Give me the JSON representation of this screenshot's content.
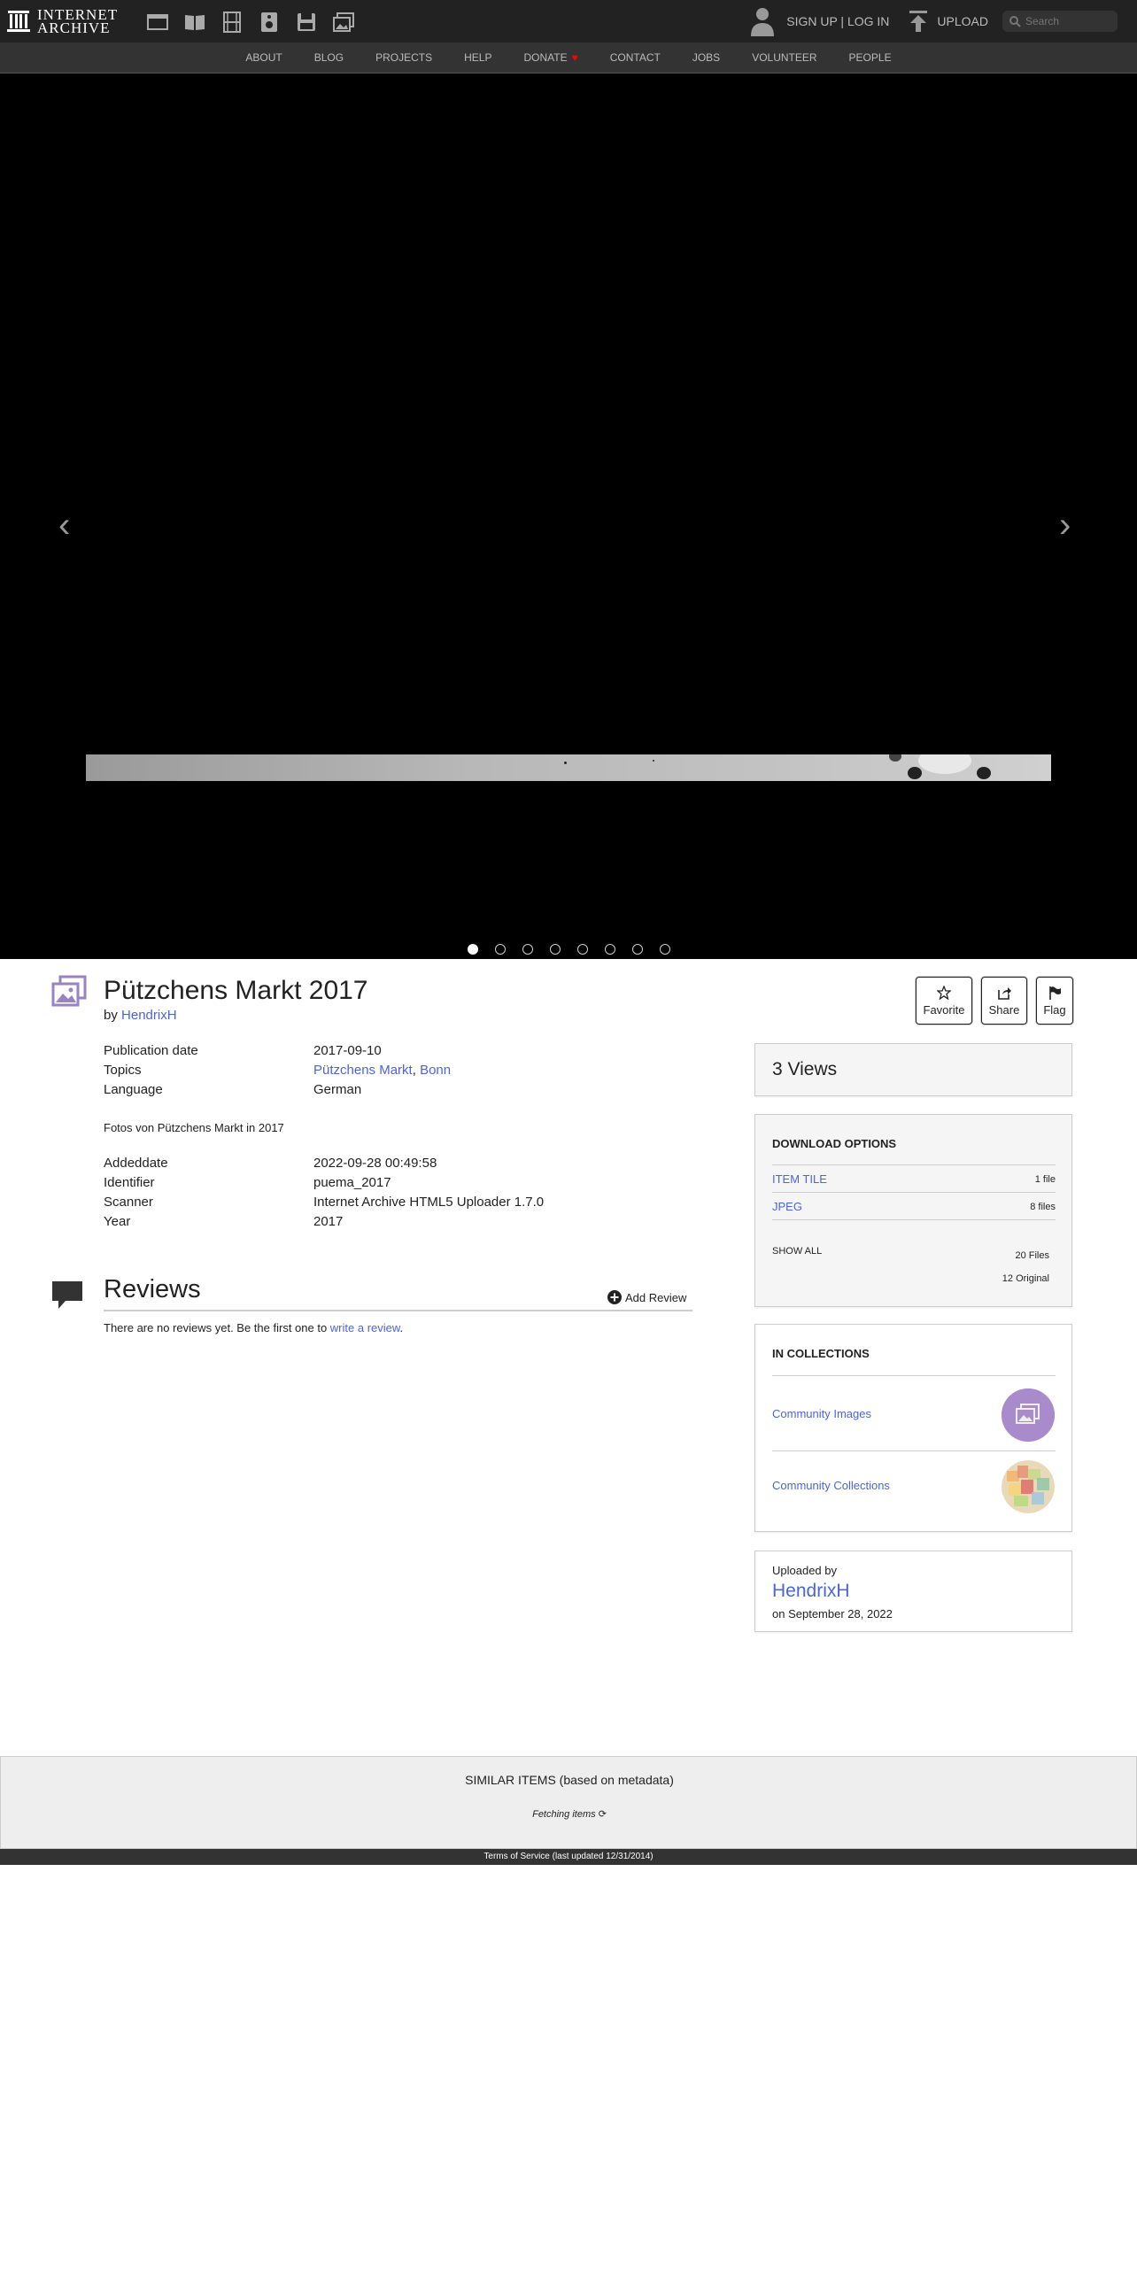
{
  "topnav": {
    "logo_text_line1": "INTERNET",
    "logo_text_line2": "ARCHIVE",
    "media_icons": [
      "web-icon",
      "texts-icon",
      "video-icon",
      "audio-icon",
      "software-icon",
      "images-icon"
    ],
    "auth_label": "SIGN UP | LOG IN",
    "upload_label": "UPLOAD",
    "search_placeholder": "Search"
  },
  "subnav": {
    "items": [
      "ABOUT",
      "BLOG",
      "PROJECTS",
      "HELP",
      "DONATE",
      "CONTACT",
      "JOBS",
      "VOLUNTEER",
      "PEOPLE"
    ]
  },
  "theater": {
    "slide_count": 8,
    "active_slide": 1,
    "prev_label": "‹",
    "next_label": "›"
  },
  "item": {
    "title": "Pützchens Markt 2017",
    "by_label": "by",
    "creator": "HendrixH",
    "actions": {
      "favorite": "Favorite",
      "share": "Share",
      "flag": "Flag"
    },
    "metadata": {
      "publication_date_key": "Publication date",
      "publication_date_val": "2017-09-10",
      "topics_key": "Topics",
      "topic_1": "Pützchens Markt",
      "topic_sep": ", ",
      "topic_2": "Bonn",
      "language_key": "Language",
      "language_val": "German",
      "description": "Fotos von Pützchens Markt in 2017",
      "addeddate_key": "Addeddate",
      "addeddate_val": "2022-09-28 00:49:58",
      "identifier_key": "Identifier",
      "identifier_val": "puema_2017",
      "scanner_key": "Scanner",
      "scanner_val": "Internet Archive HTML5 Uploader 1.7.0",
      "year_key": "Year",
      "year_val": "2017"
    }
  },
  "reviews": {
    "title": "Reviews",
    "add_label": "Add Review",
    "empty_text": "There are no reviews yet. Be the first one to ",
    "empty_link": "write a review",
    "empty_end": "."
  },
  "sidebar": {
    "views": "3 Views",
    "download": {
      "title": "DOWNLOAD OPTIONS",
      "rows": [
        {
          "name": "ITEM TILE",
          "count": "1 file"
        },
        {
          "name": "JPEG",
          "count": "8 files"
        }
      ],
      "show_all": "SHOW ALL",
      "total_files": "20 Files",
      "original": "12 Original"
    },
    "collections": {
      "title": "IN COLLECTIONS",
      "items": [
        {
          "name": "Community Images"
        },
        {
          "name": "Community Collections"
        }
      ]
    },
    "uploader": {
      "label": "Uploaded by",
      "name": "HendrixH",
      "date": "on September 28, 2022"
    }
  },
  "similar": {
    "title": "SIMILAR ITEMS (based on metadata)",
    "status": "Fetching items"
  },
  "footer": {
    "text": "Terms of Service (last updated 12/31/2014)"
  },
  "colors": {
    "link": "#4b64de",
    "nav_bg": "#222222",
    "subnav_bg": "#333333",
    "donate_heart": "#ff0000",
    "images_accent": "#9a82c4"
  }
}
